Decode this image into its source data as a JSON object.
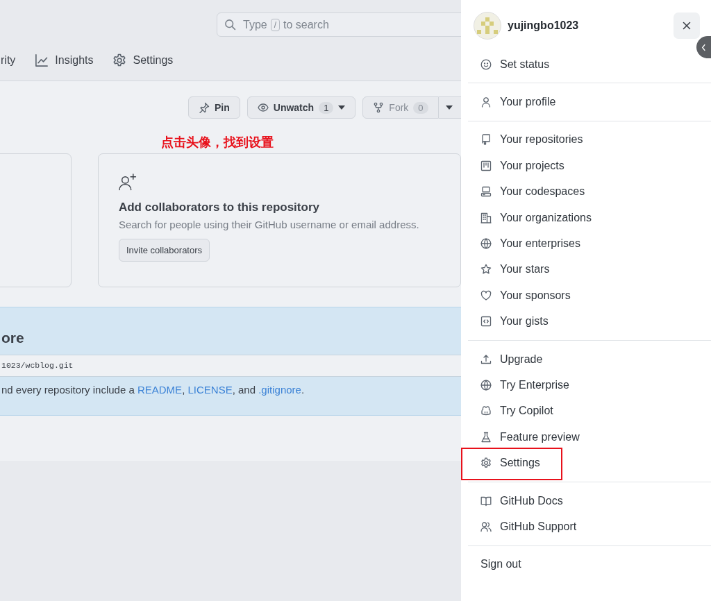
{
  "page": {
    "search": {
      "before": "Type",
      "key": "/",
      "after": "to search"
    },
    "tabs": [
      {
        "label": "rity"
      },
      {
        "label": "Insights"
      },
      {
        "label": "Settings"
      }
    ],
    "actions": {
      "pin": "Pin",
      "watch": {
        "label": "Unwatch",
        "count": "1"
      },
      "fork": {
        "label": "Fork",
        "count": "0"
      }
    },
    "annotation": "点击头像，找到设置",
    "collab_card": {
      "title": "Add collaborators to this repository",
      "subtitle": "Search for people using their GitHub username or email address.",
      "button": "Invite collaborators"
    },
    "quick_setup": {
      "heading": "ore",
      "clone_url": "1023/wcblog.git",
      "note": [
        {
          "kind": "text",
          "text": "nd every repository include a "
        },
        {
          "kind": "link",
          "text": "README"
        },
        {
          "kind": "text",
          "text": ", "
        },
        {
          "kind": "link",
          "text": "LICENSE"
        },
        {
          "kind": "text",
          "text": ", and "
        },
        {
          "kind": "link",
          "text": ".gitignore"
        },
        {
          "kind": "text",
          "text": "."
        }
      ]
    }
  },
  "drawer": {
    "username": "yujingbo1023",
    "groups": [
      [
        {
          "label": "Set status",
          "highlighted": false
        }
      ],
      [
        {
          "label": "Your profile",
          "highlighted": false
        }
      ],
      [
        {
          "label": "Your repositories",
          "highlighted": false
        },
        {
          "label": "Your projects",
          "highlighted": false
        },
        {
          "label": "Your codespaces",
          "highlighted": false
        },
        {
          "label": "Your organizations",
          "highlighted": false
        },
        {
          "label": "Your enterprises",
          "highlighted": false
        },
        {
          "label": "Your stars",
          "highlighted": false
        },
        {
          "label": "Your sponsors",
          "highlighted": false
        },
        {
          "label": "Your gists",
          "highlighted": false
        }
      ],
      [
        {
          "label": "Upgrade",
          "highlighted": false
        },
        {
          "label": "Try Enterprise",
          "highlighted": false
        },
        {
          "label": "Try Copilot",
          "highlighted": false
        },
        {
          "label": "Feature preview",
          "highlighted": false
        },
        {
          "label": "Settings",
          "highlighted": true
        }
      ],
      [
        {
          "label": "GitHub Docs",
          "highlighted": false
        },
        {
          "label": "GitHub Support",
          "highlighted": false
        }
      ],
      [
        {
          "label": "Sign out",
          "highlighted": false
        }
      ]
    ]
  }
}
